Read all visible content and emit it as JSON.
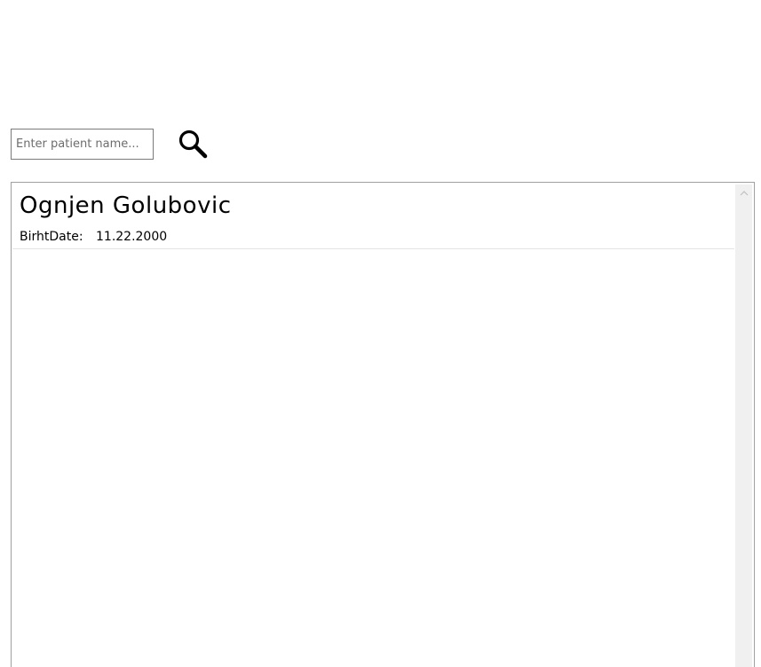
{
  "search": {
    "placeholder": "Enter patient name...",
    "value": "",
    "button_icon": "search-icon"
  },
  "patients": [
    {
      "name": "Ognjen Golubovic",
      "birth_label": "BirhtDate:",
      "birth_date": "11.22.2000"
    }
  ],
  "scrollbar": {
    "up_icon": "chevron-up-icon"
  }
}
